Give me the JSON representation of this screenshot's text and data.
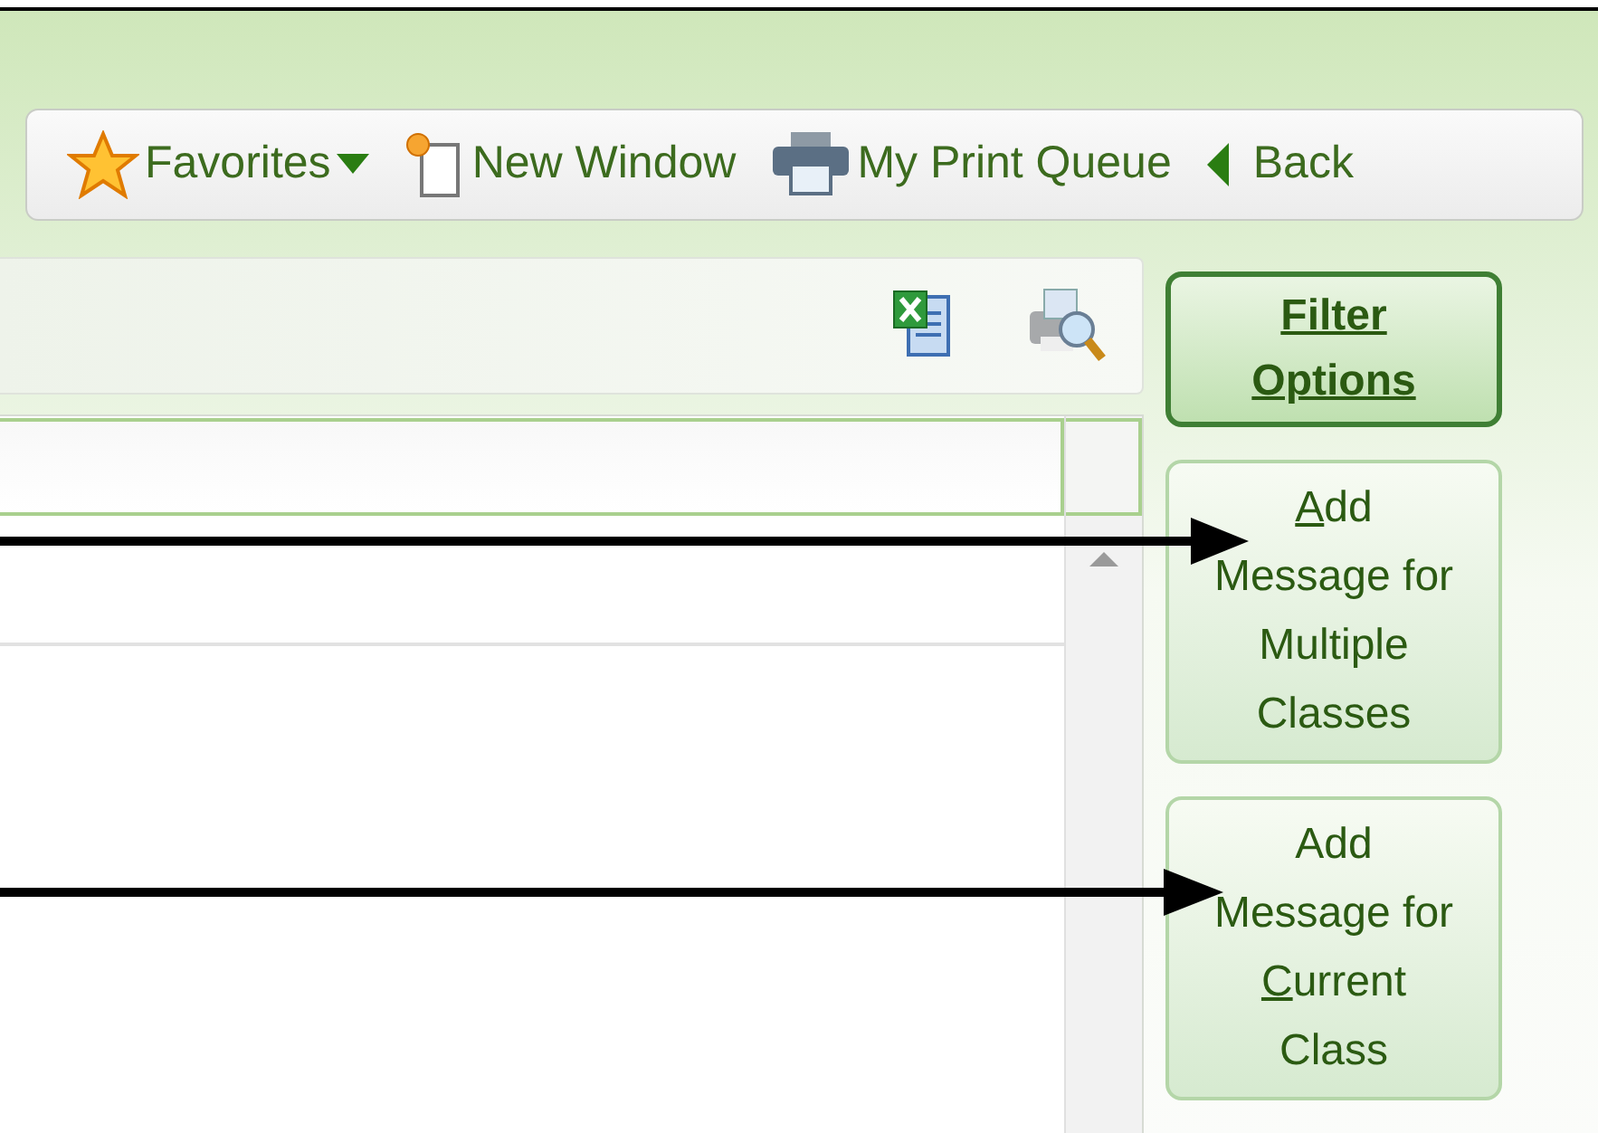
{
  "toolbar": {
    "items": [
      {
        "kind": "favorites",
        "label": "Favorites"
      },
      {
        "kind": "new_window",
        "label": "New Window"
      },
      {
        "kind": "print_queue",
        "label": "My Print Queue"
      },
      {
        "kind": "back",
        "label": "Back"
      }
    ]
  },
  "side_buttons": [
    {
      "kind": "primary",
      "lines": [
        {
          "text": "Filter"
        },
        {
          "text": "Options"
        }
      ]
    },
    {
      "kind": "secondary",
      "lines": [
        {
          "key": "A",
          "text": "dd"
        },
        {
          "text": "Message for"
        },
        {
          "text": "Multiple"
        },
        {
          "text": "Classes"
        }
      ]
    },
    {
      "kind": "secondary",
      "lines": [
        {
          "text": "Add"
        },
        {
          "text": "Message for"
        },
        {
          "key": "C",
          "text": "urrent"
        },
        {
          "text": "Class"
        }
      ]
    }
  ]
}
